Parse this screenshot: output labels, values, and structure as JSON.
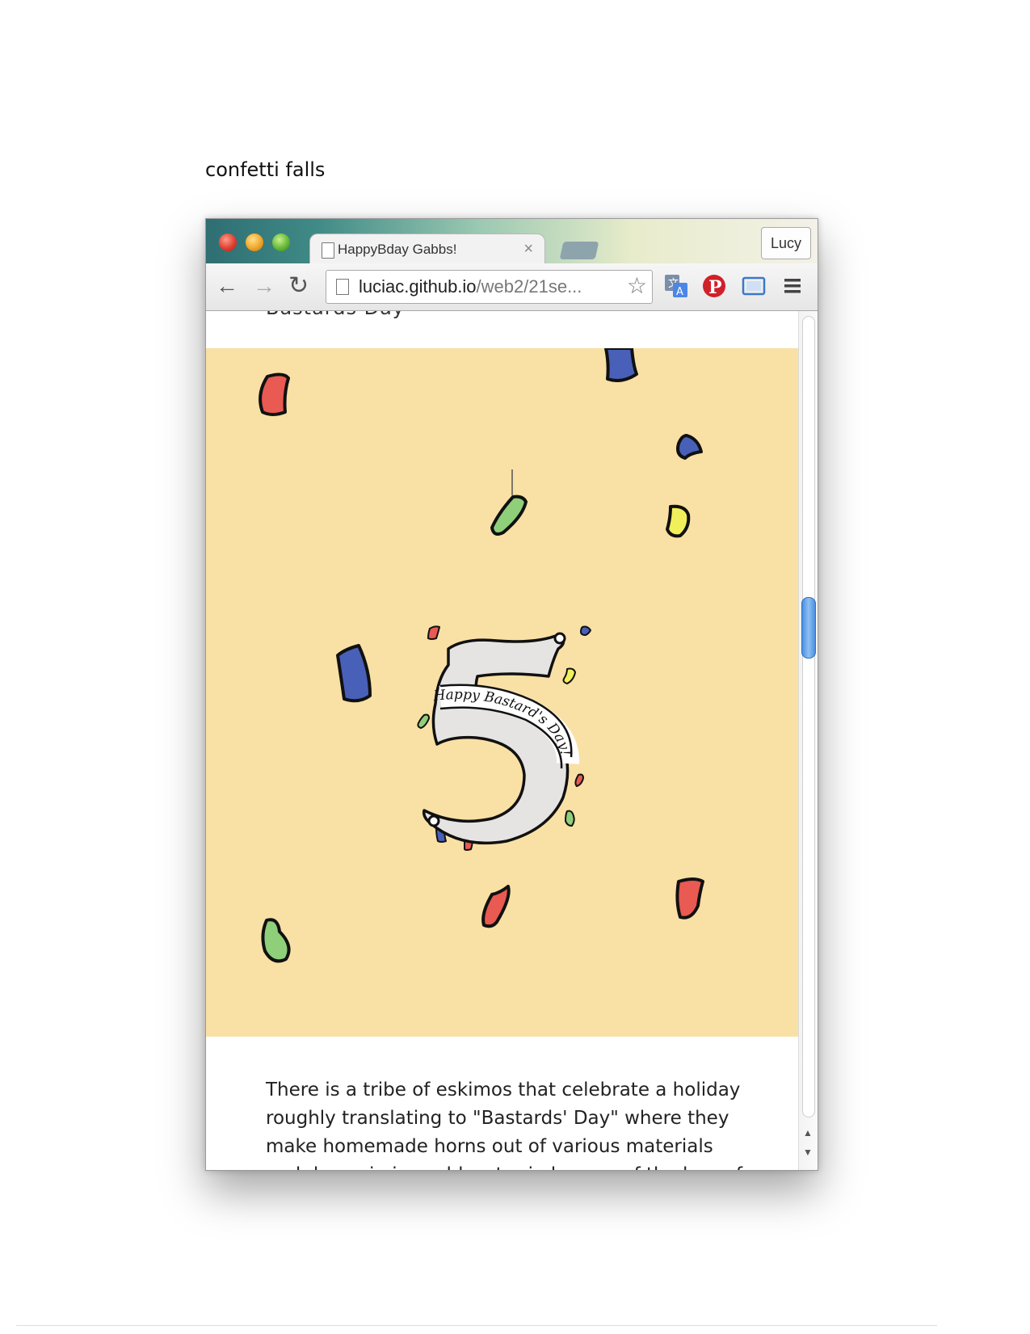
{
  "caption": "confetti falls",
  "browser": {
    "tab_title": "HappyBday Gabbs!",
    "tab_close": "×",
    "profile_name": "Lucy",
    "url_host": "luciac.github.io",
    "url_path": "/web2/21se...",
    "nav": {
      "back": "←",
      "forward": "→",
      "reload": "↻"
    },
    "star": "☆",
    "icons": [
      "translate-icon",
      "pinterest-icon",
      "cast-icon",
      "menu-icon"
    ]
  },
  "page": {
    "cut_off_heading": "Bastards Day",
    "banner_text": "Happy Bastard's Day!",
    "story_text": "There is a tribe of eskimos that celebrate a holiday roughly translating to \"Bastards' Day\" where they make homemade horns out of various materials and dance in ice cold water in honour of the loss of",
    "scroll_position": 0.38,
    "colors": {
      "hero_bg": "#f9e0a5",
      "confetti_red": "#e85a52",
      "confetti_blue": "#4860b8",
      "confetti_green": "#8fcf7a",
      "confetti_yellow": "#f2f05a",
      "banner_fill": "#e6e3e3"
    }
  }
}
